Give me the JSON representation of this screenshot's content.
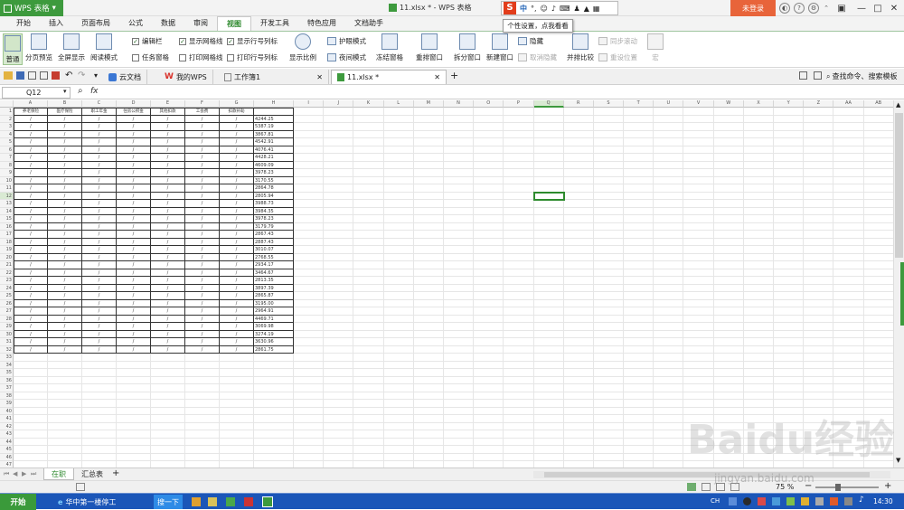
{
  "titlebar": {
    "app_name": "WPS 表格",
    "doc_title": "11.xlsx * - WPS 表格",
    "login": "未登录",
    "ime_label": "中",
    "ime_tip": "个性设置，点我看看"
  },
  "menu": [
    "开始",
    "插入",
    "页面布局",
    "公式",
    "数据",
    "审阅",
    "视图",
    "开发工具",
    "特色应用",
    "文档助手"
  ],
  "ribbon": {
    "normal": "普通",
    "page_preview": "分页预览",
    "fullscreen": "全屏显示",
    "reading": "阅读模式",
    "edit_bar": "编辑栏",
    "task_pane": "任务窗格",
    "show_grid": "显示网格线",
    "print_grid": "打印网格线",
    "show_rowcol": "显示行号列标",
    "print_rowcol": "打印行号列标",
    "zoom": "显示比例",
    "eye_mode": "护眼模式",
    "night_mode": "夜间模式",
    "freeze": "冻结窗格",
    "rearrange": "重排窗口",
    "split": "拆分窗口",
    "new_window": "新建窗口",
    "hide": "隐藏",
    "unhide": "取消隐藏",
    "side_by_side": "并排比较",
    "sync_scroll": "同步滚动",
    "reset_pos": "重设位置",
    "macro": "宏"
  },
  "qat": {
    "tabs": [
      "云文档",
      "我的WPS",
      "工作簿1",
      "11.xlsx *"
    ],
    "search": "查找命令、搜索模板"
  },
  "formula": {
    "cell_ref": "Q12",
    "fx": "fx",
    "value": ""
  },
  "grid": {
    "columns": [
      "A",
      "B",
      "C",
      "D",
      "E",
      "F",
      "G",
      "H",
      "I",
      "J",
      "K",
      "L",
      "M",
      "N",
      "O",
      "P",
      "Q",
      "R",
      "S",
      "T",
      "U",
      "V",
      "W",
      "X",
      "Y",
      "Z",
      "AA",
      "AB"
    ],
    "headers": [
      "养老保险",
      "医疗保险",
      "职工年金",
      "住房公积金",
      "其他扣款",
      "工会费",
      "扣款补助"
    ],
    "blank_mark": "/",
    "h_values": [
      "4244.25",
      "5387.19",
      "3867.81",
      "4542.91",
      "4076.41",
      "4428.21",
      "4609.09",
      "3978.23",
      "3170.55",
      "2864.78",
      "2805.94",
      "3988.73",
      "3984.35",
      "3978.23",
      "3179.79",
      "2867.43",
      "2887.43",
      "3010.07",
      "2768.55",
      "2934.17",
      "3464.67",
      "2813.35",
      "3897.39",
      "2865.87",
      "3195.00",
      "2964.91",
      "4469.71",
      "3069.98",
      "3274.19",
      "3630.96",
      "2861.75"
    ],
    "row_numbers": [
      "1",
      "2",
      "3",
      "4",
      "5",
      "6",
      "7",
      "8",
      "9",
      "10",
      "11",
      "12",
      "13",
      "14",
      "15",
      "16",
      "17",
      "18",
      "19",
      "20",
      "21",
      "22",
      "23",
      "24",
      "25",
      "26",
      "27",
      "28",
      "29",
      "30",
      "31",
      "32",
      "33",
      "34",
      "35",
      "36",
      "37",
      "38",
      "39",
      "40",
      "41",
      "42",
      "43",
      "44",
      "45",
      "46",
      "47"
    ]
  },
  "sheets": [
    "在职",
    "汇总表"
  ],
  "status": {
    "zoom": "75 %"
  },
  "taskbar": {
    "start": "开始",
    "items": [
      "华中第一楼停工",
      "搜一下"
    ],
    "clock": "14:30",
    "lang": "CH"
  },
  "watermark": {
    "logo": "Baidu经验",
    "url": "jingyan.baidu.com"
  }
}
